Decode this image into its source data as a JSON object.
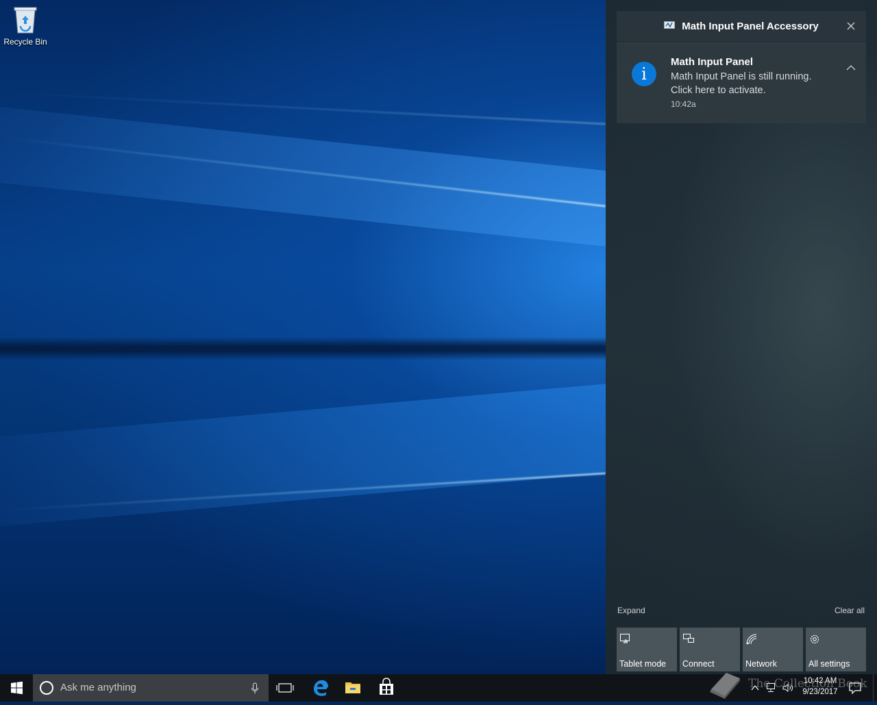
{
  "desktop": {
    "icons": [
      {
        "label": "Recycle Bin",
        "icon": "recycle-bin-icon"
      }
    ]
  },
  "action_center": {
    "group_header": {
      "app_name": "Math Input Panel Accessory",
      "icon": "math-input-panel-icon",
      "close_icon": "close-icon"
    },
    "notification": {
      "title": "Math Input Panel",
      "body_line1": "Math Input Panel is still running.",
      "body_line2": "Click here to activate.",
      "time": "10:42a",
      "icon": "info-icon",
      "icon_glyph": "i",
      "collapse_icon": "chevron-up-icon"
    },
    "expand_label": "Expand",
    "clear_all_label": "Clear all",
    "quick_actions": [
      {
        "label": "Tablet mode",
        "icon": "tablet-mode-icon"
      },
      {
        "label": "Connect",
        "icon": "connect-icon"
      },
      {
        "label": "Network",
        "icon": "network-icon"
      },
      {
        "label": "All settings",
        "icon": "gear-icon"
      }
    ]
  },
  "taskbar": {
    "search_placeholder": "Ask me anything",
    "pinned": [
      {
        "name": "task-view",
        "icon": "task-view-icon"
      },
      {
        "name": "edge",
        "icon": "edge-icon"
      },
      {
        "name": "file-explorer",
        "icon": "folder-icon"
      },
      {
        "name": "store",
        "icon": "store-icon"
      }
    ],
    "clock": {
      "time": "10:42 AM",
      "date": "9/23/2017"
    }
  },
  "watermark": {
    "text": "The Collection Book"
  },
  "colors": {
    "accent": "#0a78d7",
    "taskbar": "#101418",
    "action_center_bg": "#1d2a34",
    "tile": "#4a545b"
  }
}
